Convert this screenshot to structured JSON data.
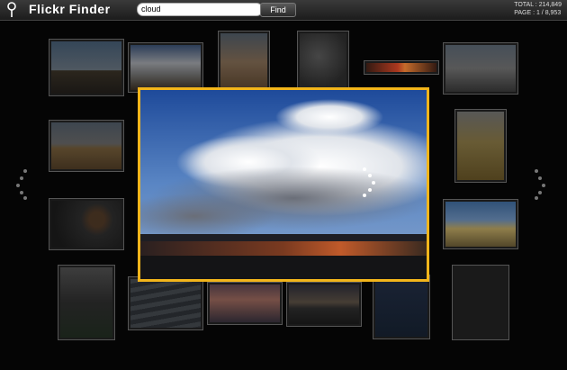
{
  "app": {
    "title": "Flickr Finder"
  },
  "search": {
    "value": "cloud",
    "find_label": "Find"
  },
  "stats": {
    "total_label": "TOTAL : 214,849",
    "page_label": "PAGE : 1 / 8,953"
  },
  "colors": {
    "focus_border": "#f2b51b",
    "background": "#000000",
    "topbar": "#2a2a2a"
  },
  "icons": {
    "logo": "map-pin-icon",
    "prev": "chevron-left-dots-icon",
    "next": "chevron-right-dots-icon",
    "loading": "loading-spinner-icon"
  },
  "gallery": {
    "thumbnails": [
      {
        "subject": "city-skyline-dusk"
      },
      {
        "subject": "clouds-over-land"
      },
      {
        "subject": "aerial-desert"
      },
      {
        "subject": "dark-textured-clouds"
      },
      {
        "subject": "red-sunset-strip"
      },
      {
        "subject": "city-towers"
      },
      {
        "subject": "wheat-field-sky"
      },
      {
        "subject": "golden-grass"
      },
      {
        "subject": "dark-balloon-sky"
      },
      {
        "subject": "pampas-grass-blue-sky"
      },
      {
        "subject": "tree-silhouette"
      },
      {
        "subject": "cloud-texture"
      },
      {
        "subject": "pink-sunset-water"
      },
      {
        "subject": "evening-coastline"
      },
      {
        "subject": "blue-dusk"
      },
      {
        "subject": "black-white-pier"
      }
    ],
    "focused": {
      "subject": "storm-cloud-over-canyon"
    }
  }
}
